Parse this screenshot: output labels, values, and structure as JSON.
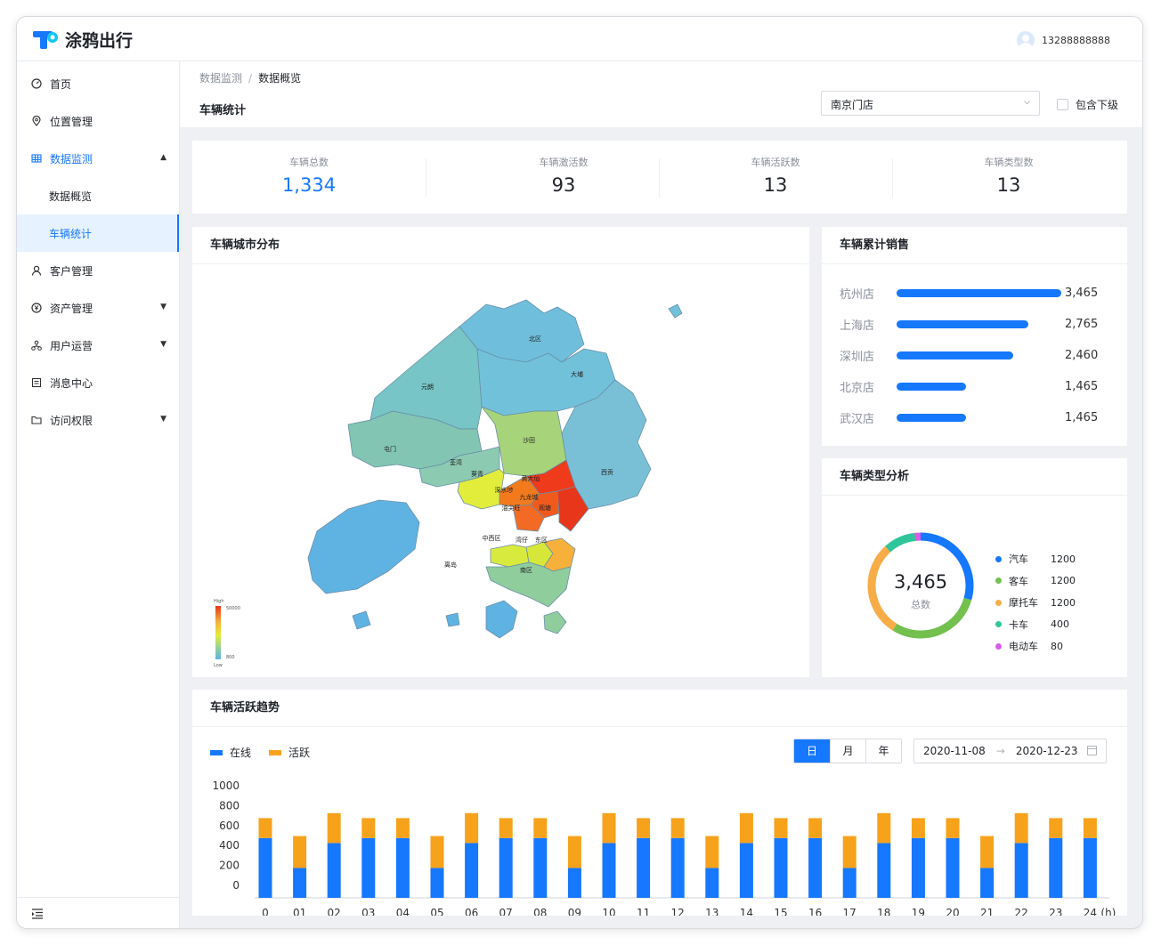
{
  "brand": {
    "name": "涂鸦出行",
    "logo_color": "#1677ff"
  },
  "user": {
    "phone": "13288888888"
  },
  "sidebar": {
    "items": [
      {
        "label": "首页",
        "icon": "dashboard-icon"
      },
      {
        "label": "位置管理",
        "icon": "location-icon"
      },
      {
        "label": "数据监测",
        "icon": "table-icon",
        "expanded": true
      },
      {
        "label": "数据概览"
      },
      {
        "label": "车辆统计",
        "selected": true
      },
      {
        "label": "客户管理",
        "icon": "user-icon"
      },
      {
        "label": "资产管理",
        "icon": "yen-icon"
      },
      {
        "label": "用户运营",
        "icon": "cluster-icon"
      },
      {
        "label": "消息中心",
        "icon": "message-icon"
      },
      {
        "label": "访问权限",
        "icon": "folder-icon"
      }
    ]
  },
  "breadcrumb": {
    "parent": "数据监测",
    "sep": "/",
    "current": "数据概览"
  },
  "page_title": "车辆统计",
  "store_select": {
    "value": "南京门店"
  },
  "include_sub": {
    "label": "包含下级",
    "checked": false
  },
  "stats": [
    {
      "label": "车辆总数",
      "value": "1,334"
    },
    {
      "label": "车辆激活数",
      "value": "93"
    },
    {
      "label": "车辆活跃数",
      "value": "13"
    },
    {
      "label": "车辆类型数",
      "value": "13"
    }
  ],
  "map_card": {
    "title": "车辆城市分布",
    "legend_high": "High",
    "legend_low": "Low",
    "legend_max": "50000",
    "legend_min": "800",
    "regions": [
      "北区",
      "大埔",
      "元朗",
      "屯门",
      "沙田",
      "荃湾",
      "葵青",
      "黄大仙",
      "深水埗",
      "九龙城",
      "油尖旺",
      "观塘",
      "西贡",
      "离岛",
      "中西区",
      "湾仔",
      "东区",
      "南区"
    ]
  },
  "sales_card": {
    "title": "车辆累计销售",
    "rows": [
      {
        "name": "杭州店",
        "value": 3465,
        "label": "3,465"
      },
      {
        "name": "上海店",
        "value": 2765,
        "label": "2,765"
      },
      {
        "name": "深圳店",
        "value": 2460,
        "label": "2,460"
      },
      {
        "name": "北京店",
        "value": 1465,
        "label": "1,465"
      },
      {
        "name": "武汉店",
        "value": 1465,
        "label": "1,465"
      }
    ]
  },
  "type_card": {
    "title": "车辆类型分析",
    "total": "3,465",
    "total_label": "总数",
    "items": [
      {
        "name": "汽车",
        "value": 1200,
        "color": "#1677ff"
      },
      {
        "name": "客车",
        "value": 1200,
        "color": "#73c04e"
      },
      {
        "name": "摩托车",
        "value": 1200,
        "color": "#f7ad47"
      },
      {
        "name": "卡车",
        "value": 400,
        "color": "#2fc59b"
      },
      {
        "name": "电动车",
        "value": 80,
        "color": "#d85de6"
      }
    ]
  },
  "trend_card": {
    "title": "车辆活跃趋势",
    "segments": [
      "日",
      "月",
      "年"
    ],
    "active_segment": "日",
    "date_start": "2020-11-08",
    "date_end": "2020-12-23"
  },
  "chart_data": {
    "type": "bar",
    "stacked": true,
    "categories": [
      "0",
      "01",
      "02",
      "03",
      "04",
      "05",
      "06",
      "07",
      "08",
      "09",
      "10",
      "11",
      "12",
      "13",
      "14",
      "15",
      "16",
      "17",
      "18",
      "19",
      "20",
      "21",
      "22",
      "23",
      "24"
    ],
    "x_unit": "(h)",
    "yticks": [
      0,
      200,
      400,
      600,
      800,
      1000
    ],
    "ylim": [
      0,
      1000
    ],
    "series": [
      {
        "name": "在线",
        "color": "#1677ff",
        "values": [
          600,
          300,
          550,
          600,
          600,
          300,
          550,
          600,
          600,
          300,
          550,
          600,
          600,
          300,
          550,
          600,
          600,
          300,
          550,
          600,
          600,
          300,
          550,
          600,
          600
        ]
      },
      {
        "name": "活跃",
        "color": "#f7a21b",
        "values": [
          200,
          320,
          300,
          200,
          200,
          320,
          300,
          200,
          200,
          320,
          300,
          200,
          200,
          320,
          300,
          200,
          200,
          320,
          300,
          200,
          200,
          320,
          300,
          200,
          200
        ]
      }
    ],
    "grid": false,
    "legend": "top-left"
  }
}
